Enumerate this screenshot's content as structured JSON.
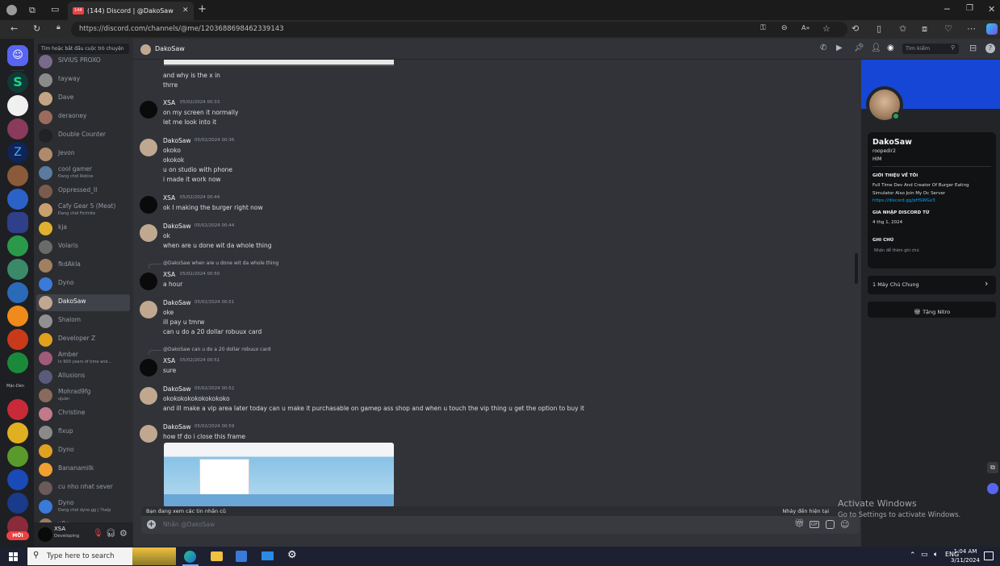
{
  "browser": {
    "tab_title": "(144) Discord | @DakoSaw",
    "tab_badge": "144",
    "url": "https://discord.com/channels/@me/1203688698462339143",
    "search_placeholder": "Tìm kiếm"
  },
  "dm_list": {
    "search_placeholder": "Tìm hoặc bắt đầu cuộc trò chuyện",
    "items": [
      {
        "name": "SIVIUS PROXO",
        "status": "",
        "color": "#7a6a8a"
      },
      {
        "name": "tayway",
        "status": "",
        "color": "#8b8b8b"
      },
      {
        "name": "Dave",
        "status": "",
        "color": "#c4a484"
      },
      {
        "name": "deraoney",
        "status": "",
        "color": "#9b6b5b"
      },
      {
        "name": "Double Counter",
        "status": "",
        "color": "#202225"
      },
      {
        "name": "Jevon",
        "status": "",
        "color": "#b08a6a"
      },
      {
        "name": "cool gamer",
        "status": "Đang chơi Roblox",
        "color": "#5a7aa0"
      },
      {
        "name": "Oppressed_II",
        "status": "",
        "color": "#7b5b4b"
      },
      {
        "name": "Cafy Gear 5 (Meat)",
        "status": "Đang chơi Fortnite",
        "color": "#c8a070"
      },
      {
        "name": "kja",
        "status": "",
        "color": "#e0b030"
      },
      {
        "name": "Volaris",
        "status": "",
        "color": "#6a6a6a"
      },
      {
        "name": "fkdAkla",
        "status": "",
        "color": "#a08060"
      },
      {
        "name": "Dyno",
        "status": "",
        "color": "#3a7ad8"
      },
      {
        "name": "DakoSaw",
        "status": "",
        "color": "#c0a890"
      },
      {
        "name": "Shalom",
        "status": "",
        "color": "#909090"
      },
      {
        "name": "Developer Z",
        "status": "",
        "color": "#e0a020"
      },
      {
        "name": "Amber",
        "status": "In 900 years of time and...",
        "color": "#a05a7a"
      },
      {
        "name": "Allusions",
        "status": "",
        "color": "#5a5a7a"
      },
      {
        "name": "Mohrad9fg",
        "status": "ưjuàn",
        "color": "#8a6a5a"
      },
      {
        "name": "Christine",
        "status": "",
        "color": "#c07a8a"
      },
      {
        "name": "flxup",
        "status": "",
        "color": "#8a8a8a"
      },
      {
        "name": "Dyno",
        "status": "",
        "color": "#e0a020"
      },
      {
        "name": "Bananamilk",
        "status": "",
        "color": "#f0a030"
      },
      {
        "name": "cu nho nhat sever",
        "status": "",
        "color": "#6a5a5a"
      },
      {
        "name": "Dyno",
        "status": "Đang chơi dyno.gg | ?help",
        "color": "#3a7ad8"
      },
      {
        "name": "x9o",
        "status": "",
        "color": "#9a7a6a"
      }
    ]
  },
  "user_panel": {
    "name": "XSA",
    "status": "Developing"
  },
  "guild_badge": "MỚI",
  "guild_label": "Mặc-Dèn",
  "header": {
    "name": "DakoSaw"
  },
  "messages": [
    {
      "type": "cont",
      "lines": [
        "and why is the x in",
        "thrre"
      ]
    },
    {
      "type": "group",
      "author": "XSA",
      "ts": "05/02/2024 00:33",
      "lines": [
        "on my screen it normally",
        "let me look into it"
      ]
    },
    {
      "type": "group",
      "author": "DakoSaw",
      "ts": "05/02/2024 00:36",
      "lines": [
        "okoko",
        "okokok",
        "u on studio with phone",
        "i made it work now"
      ]
    },
    {
      "type": "group",
      "author": "XSA",
      "ts": "05/02/2024 00:44",
      "lines": [
        "ok I making the burger right now"
      ]
    },
    {
      "type": "group",
      "author": "DakoSaw",
      "ts": "05/02/2024 00:44",
      "lines": [
        "ok",
        "when are u done wit da whole thing"
      ]
    },
    {
      "type": "group",
      "author": "XSA",
      "ts": "05/02/2024 00:50",
      "reply": "@DakoSaw when are u done wit da whole thing",
      "lines": [
        "a hour"
      ]
    },
    {
      "type": "group",
      "author": "DakoSaw",
      "ts": "05/02/2024 00:51",
      "lines": [
        "oke",
        "ill pay u tmrw",
        "can u do a 20  dollar robuux card"
      ]
    },
    {
      "type": "group",
      "author": "XSA",
      "ts": "05/02/2024 00:51",
      "reply": "@DakoSaw can u do a 20 dollar robuux card",
      "lines": [
        "sure"
      ]
    },
    {
      "type": "group",
      "author": "DakoSaw",
      "ts": "05/02/2024 00:52",
      "lines": [
        "okokokokokokokokoko",
        "and ill make a vip area later today can u make it purchasable on gamep ass shop and  when u touch the vip thing u get the option to buy it"
      ]
    },
    {
      "type": "group",
      "author": "DakoSaw",
      "ts": "05/02/2024 00:59",
      "lines": [
        "how tf do i close this frame"
      ]
    }
  ],
  "reading_bar": {
    "left": "Bạn đang xem các tin nhắn cũ",
    "right": "Nhảy đến hiện tại"
  },
  "composer": {
    "placeholder": "Nhắn @DakoSaw"
  },
  "profile": {
    "display_name": "DakoSaw",
    "username": "roopedir2",
    "pronouns": "HIM",
    "about_heading": "GIỚI THIỆU VỀ TÔI",
    "about_line1": "Full Time Dev And Creator Of Burger Eating",
    "about_line2": "Simulator Also Join My Dc Server",
    "about_link": "https://discord.gg/pHSWGx3",
    "joined_heading": "GIA NHẬP DISCORD TỪ",
    "joined_date": "4 thg 1, 2024",
    "note_heading": "GHI CHÚ",
    "note_placeholder": "Nhấn để thêm ghi chú",
    "mutual": "1 Máy Chủ Chung",
    "nitro": "Tặng Nitro",
    "banner_color": "#1646d6"
  },
  "watermark": {
    "line1": "Activate Windows",
    "line2": "Go to Settings to activate Windows."
  },
  "taskbar": {
    "search": "Type here to search",
    "time": "1:04 AM",
    "date": "3/11/2024"
  }
}
